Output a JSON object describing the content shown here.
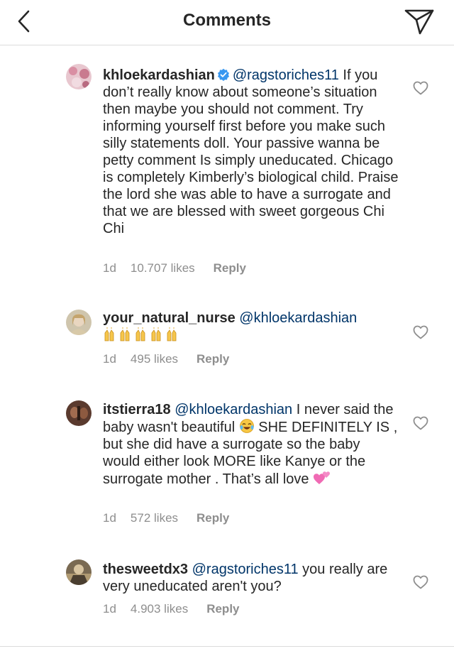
{
  "header": {
    "title": "Comments",
    "back_icon": "chevron-left-icon",
    "send_icon": "paper-plane-icon"
  },
  "comments": [
    {
      "username": "khloekardashian",
      "verified": true,
      "mention": "@ragstoriches11",
      "text": " If you don’t really know  about someone’s situation then maybe you should not comment. Try informing yourself first before you make such silly statements doll. Your passive wanna be petty comment Is simply uneducated. Chicago is completely Kimberly’s biological child. Praise the lord she was able to have a surrogate and that we are blessed with sweet gorgeous Chi Chi",
      "time": "1d",
      "likes": "10.707 likes",
      "reply": "Reply"
    },
    {
      "username": "your_natural_nurse",
      "verified": false,
      "mention": "@khloekardashian",
      "text": "",
      "emoji": "praise-hands-emoji x5",
      "time": "1d",
      "likes": "495 likes",
      "reply": "Reply"
    },
    {
      "username": "itstierra18",
      "verified": false,
      "mention": "@khloekardashian",
      "text_1": " I never said the baby wasn't beautiful ",
      "emoji_1": "tears-of-joy-emoji",
      "text_2": " SHE DEFINITELY IS , but she did have a surrogate so the baby would either look MORE like Kanye or the surrogate mother . That’s all love ",
      "emoji_2": "two-hearts-emoji",
      "time": "1d",
      "likes": "572 likes",
      "reply": "Reply"
    },
    {
      "username": "thesweetdx3",
      "verified": false,
      "mention": "@ragstoriches11",
      "text": " you really are very uneducated aren't you?",
      "time": "1d",
      "likes": "4.903 likes",
      "reply": "Reply"
    }
  ],
  "colors": {
    "text": "#262626",
    "mention": "#003569",
    "meta": "#8e8e8e",
    "verified": "#3897f0",
    "divider": "#dbdbdb"
  }
}
